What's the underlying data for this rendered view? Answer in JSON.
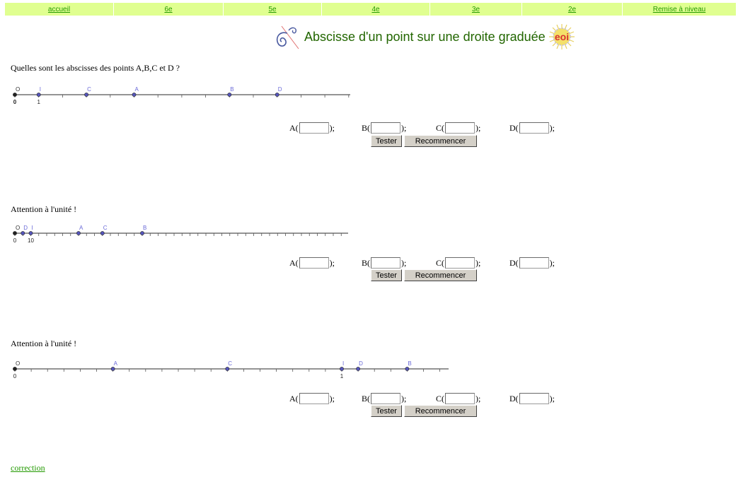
{
  "nav": {
    "items": [
      {
        "label": "accueil"
      },
      {
        "label": "6e"
      },
      {
        "label": "5e"
      },
      {
        "label": "4e"
      },
      {
        "label": "3e"
      },
      {
        "label": "2e"
      },
      {
        "label": "Remise à niveau"
      }
    ],
    "background": "#e0ff90",
    "link_color": "#229900"
  },
  "header": {
    "title": "Abscisse d'un point sur une droite graduée",
    "title_color": "#226600",
    "left_logo_icon": "swirl-logo-icon",
    "right_logo_icon": "eoi-sun-logo-icon",
    "right_logo_text": "eoi"
  },
  "exercises": [
    {
      "question": "Quelles sont les abscisses des points A,B,C et D ?",
      "axis": {
        "origin_label": "0",
        "unit_label": "1",
        "unit_point_name": "I",
        "origin_point_name": "O",
        "points": [
          {
            "name": "O",
            "position": 0
          },
          {
            "name": "I",
            "position": 1
          },
          {
            "name": "C",
            "position": 3
          },
          {
            "name": "A",
            "position": 5
          },
          {
            "name": "B",
            "position": 9
          },
          {
            "name": "D",
            "position": 11
          }
        ]
      },
      "fields": [
        {
          "label": "A(",
          "suffix": ");",
          "value": ""
        },
        {
          "label": "B(",
          "suffix": ");",
          "value": ""
        },
        {
          "label": "C(",
          "suffix": ");",
          "value": ""
        },
        {
          "label": "D(",
          "suffix": ");",
          "value": ""
        }
      ],
      "buttons": {
        "test": "Tester",
        "restart": "Recommencer"
      }
    },
    {
      "question": "Attention à l'unité !",
      "axis": {
        "origin_label": "0",
        "unit_label": "10",
        "unit_point_name": "I",
        "origin_point_name": "O",
        "points": [
          {
            "name": "O",
            "position": 0
          },
          {
            "name": "D",
            "position": 1
          },
          {
            "name": "I",
            "position": 2
          },
          {
            "name": "A",
            "position": 8
          },
          {
            "name": "C",
            "position": 11
          },
          {
            "name": "B",
            "position": 16
          }
        ]
      },
      "fields": [
        {
          "label": "A(",
          "suffix": ");",
          "value": ""
        },
        {
          "label": "B(",
          "suffix": ");",
          "value": ""
        },
        {
          "label": "C(",
          "suffix": ");",
          "value": ""
        },
        {
          "label": "D(",
          "suffix": ");",
          "value": ""
        }
      ],
      "buttons": {
        "test": "Tester",
        "restart": "Recommencer"
      }
    },
    {
      "question": "Attention à l'unité !",
      "axis": {
        "origin_label": "0",
        "unit_label": "1",
        "unit_point_name": "I",
        "origin_point_name": "O",
        "points": [
          {
            "name": "O",
            "position": 0
          },
          {
            "name": "A",
            "position": 6
          },
          {
            "name": "C",
            "position": 13
          },
          {
            "name": "I",
            "position": 20
          },
          {
            "name": "D",
            "position": 21
          },
          {
            "name": "B",
            "position": 24
          }
        ]
      },
      "fields": [
        {
          "label": "A(",
          "suffix": ");",
          "value": ""
        },
        {
          "label": "B(",
          "suffix": ");",
          "value": ""
        },
        {
          "label": "C(",
          "suffix": ");",
          "value": ""
        },
        {
          "label": "D(",
          "suffix": ");",
          "value": ""
        }
      ],
      "buttons": {
        "test": "Tester",
        "restart": "Recommencer"
      }
    }
  ],
  "footer": {
    "correction_label": "correction"
  }
}
